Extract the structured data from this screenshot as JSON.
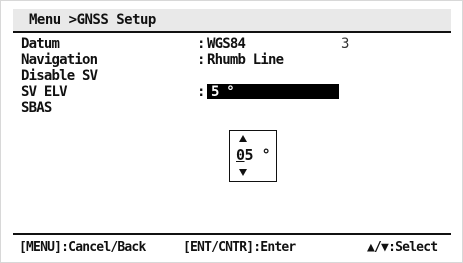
{
  "header": {
    "breadcrumb": "Menu >GNSS Setup"
  },
  "menu": {
    "items": [
      {
        "label": "Datum",
        "colon": ":",
        "value": "WGS84",
        "aux": "3"
      },
      {
        "label": "Navigation",
        "colon": ":",
        "value": "Rhumb Line"
      },
      {
        "label": "Disable SV"
      },
      {
        "label": "SV ELV",
        "colon": ":",
        "value": "5 °"
      },
      {
        "label": "SBAS"
      }
    ]
  },
  "spinner": {
    "up_icon": "up-arrow-icon",
    "down_icon": "down-arrow-icon",
    "digit_active": "0",
    "digit_rest": "5 °"
  },
  "footer": {
    "cancel": "[MENU]:Cancel/Back",
    "enter": "[ENT/CNTR]:Enter",
    "select": "▲/▼:Select"
  }
}
